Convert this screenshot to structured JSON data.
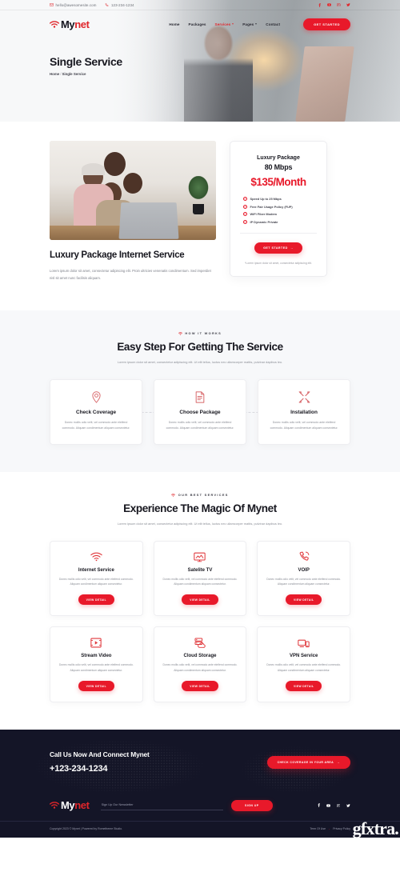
{
  "topbar": {
    "email": "hello@awesomesite.com",
    "phone": "123-234-1234",
    "socials": [
      "facebook",
      "youtube",
      "instagram",
      "twitter"
    ]
  },
  "brand": {
    "part1": "My",
    "part2": "net",
    "mark": "wifi-icon"
  },
  "nav": {
    "items": [
      {
        "label": "Home",
        "active": false,
        "dropdown": false
      },
      {
        "label": "Packages",
        "active": false,
        "dropdown": false
      },
      {
        "label": "Services",
        "active": true,
        "dropdown": true
      },
      {
        "label": "Pages",
        "active": false,
        "dropdown": true
      },
      {
        "label": "Contact",
        "active": false,
        "dropdown": false
      }
    ],
    "cta_label": "GET STARTED"
  },
  "hero": {
    "title": "Single Service",
    "crumb_home": "Home",
    "crumb_sep": "/",
    "crumb_current": "Single Service"
  },
  "package": {
    "heading": "Luxury Package Internet Service",
    "paragraph": "Lorem ipsum dolor sit amet, consectetur adipiscing elit. Proin ultricies venenatis condimentum. Sed imperdiet nisl sit amet nunc facilisis aliquam.",
    "card": {
      "name": "Luxury Package",
      "speed": "80 Mbps",
      "price": "$135/Month",
      "features": [
        "Speed Up to 25 Mbps",
        "Free Fair Usage Policy (FUP)",
        "WiFi Fiber Modem",
        "IP Dynamic Private"
      ],
      "button": "GET STARTED",
      "note": "*Lorem ipsum dolor sit amet, consectetur adipiscing elit."
    }
  },
  "steps_section": {
    "eyebrow": "HOW IT WORKS",
    "heading": "Easy Step For Getting The Service",
    "subtitle": "Lorem ipsum dolor sit amet, consectetur adipiscing elit. Ut elit tellus, luctus nec ullamcorper mattis, pulvinar dapibus leo.",
    "steps": [
      {
        "icon": "location-pin-icon",
        "title": "Check Coverage",
        "text": "Donec mollis odio velit, vel commodo ante eleifend commodo. Aliquam condimentum aliquam consectetur."
      },
      {
        "icon": "document-icon",
        "title": "Choose Package",
        "text": "Donec mollis odio velit, vel commodo ante eleifend commodo. Aliquam condimentum aliquam consectetur."
      },
      {
        "icon": "tools-icon",
        "title": "Installation",
        "text": "Donec mollis odio velit, vel commodo ante eleifend commodo. Aliquam condimentum aliquam consectetur."
      }
    ]
  },
  "services_section": {
    "eyebrow": "OUR BEST SERVICES",
    "heading": "Experience The Magic Of Mynet",
    "subtitle": "Lorem ipsum dolor sit amet, consectetur adipiscing elit. Ut elit tellus, luctus nec ullamcorper mattis, pulvinar dapibus leo.",
    "button_label": "VIEW DETAIL",
    "cards": [
      {
        "icon": "wifi-icon",
        "title": "Internet Service",
        "text": "Donec mollis odio velit, vel commodo ante eleifend commodo. Aliquam condimentum aliquam consectetur."
      },
      {
        "icon": "monitor-icon",
        "title": "Satelite TV",
        "text": "Donec mollis odio velit, vel commodo ante eleifend commodo. Aliquam condimentum aliquam consectetur."
      },
      {
        "icon": "phone-call-icon",
        "title": "VOIP",
        "text": "Donec mollis odio velit, vel commodo ante eleifend commodo. Aliquam condimentum aliquam consectetur."
      },
      {
        "icon": "video-play-icon",
        "title": "Stream Video",
        "text": "Donec mollis odio velit, vel commodo ante eleifend commodo. Aliquam condimentum aliquam consectetur."
      },
      {
        "icon": "cloud-server-icon",
        "title": "Cloud Storage",
        "text": "Donec mollis odio velit, vel commodo ante eleifend commodo. Aliquam condimentum aliquam consectetur."
      },
      {
        "icon": "devices-icon",
        "title": "VPN Service",
        "text": "Donec mollis odio velit, vel commodo ante eleifend commodo. Aliquam condimentum aliquam consectetur."
      }
    ]
  },
  "cta": {
    "heading": "Call Us Now And Connect Mynet",
    "phone": "+123-234-1234",
    "button": "CHECK COVERAGE IN YOUR AREA"
  },
  "footer": {
    "newsletter_placeholder": "Sign Up Our Newsletter",
    "newsletter_value": "",
    "signup_label": "SIGN UP",
    "socials": [
      "facebook",
      "youtube",
      "instagram",
      "twitter"
    ],
    "copyright": "Copyright 2023 © Mynet | Powered by Rometheme Studio.",
    "link_terms": "Term Of Use",
    "link_dot": "-",
    "link_privacy": "Privacy Policy"
  },
  "watermark": "gfxtra.",
  "colors": {
    "accent": "#e8192a",
    "dark": "#141527",
    "muted": "#8b8e96",
    "section_bg": "#f7f8fa"
  }
}
